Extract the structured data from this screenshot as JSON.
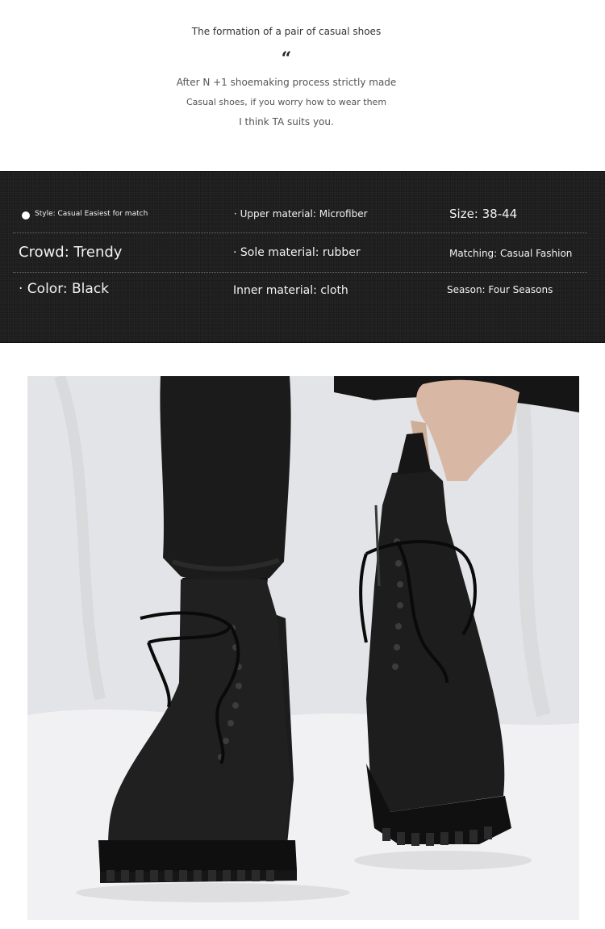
{
  "intro": {
    "title": "The formation of a pair of casual shoes",
    "quote_mark": "“",
    "line1": "After N +1 shoemaking process strictly made",
    "line2": "Casual shoes, if you worry how to wear them",
    "line3": "I think TA suits you."
  },
  "specs": {
    "style": "Style: Casual Easiest for match",
    "upper_material": "· Upper material: Microfiber",
    "size": "Size: 38-44",
    "crowd": "Crowd: Trendy",
    "sole_material": "· Sole material: rubber",
    "matching": "Matching: Casual Fashion",
    "color": "· Color: Black",
    "inner_material": "Inner material: cloth",
    "season": "Season: Four Seasons"
  },
  "colors": {
    "spec_panel_bg": "#1e1e1e",
    "spec_text": "#f2f2f2",
    "boot": "#1c1c1c",
    "backdrop": "#e4e5e8"
  }
}
